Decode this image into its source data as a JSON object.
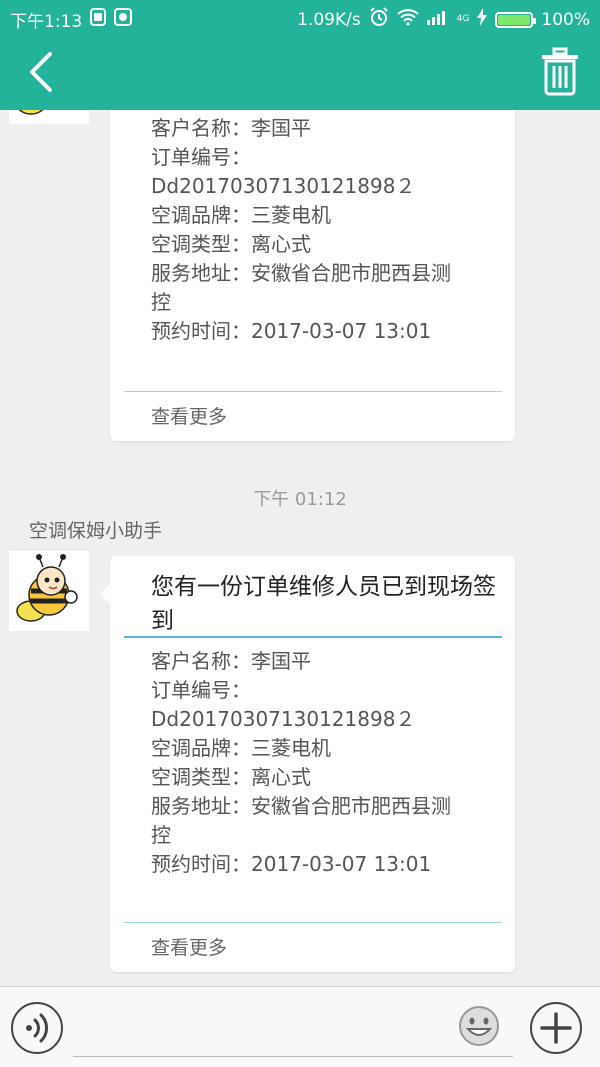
{
  "status_bar": {
    "time": "下午1:13",
    "speed": "1.09K/s",
    "network": "4G",
    "battery": "100%",
    "battery_level": 1.0
  },
  "header": {
    "back_icon": "chevron-left-icon",
    "delete_icon": "trash-icon"
  },
  "messages": [
    {
      "details": [
        "客户名称：李国平",
        "订单编号：",
        "Dd20170307130121898２",
        "空调品牌：三菱电机",
        "空调类型：离心式",
        "服务地址：安徽省合肥市肥西县测",
        "控",
        "预约时间：2017-03-07 13:01"
      ],
      "more": "查看更多"
    },
    {
      "timestamp": "下午 01:12",
      "sender": "空调保姆小助手",
      "title": "您有一份订单维修人员已到现场签到",
      "details": [
        "客户名称：李国平",
        "订单编号：",
        "Dd20170307130121898２",
        "空调品牌：三菱电机",
        "空调类型：离心式",
        "服务地址：安徽省合肥市肥西县测",
        "控",
        "预约时间：2017-03-07 13:01"
      ],
      "more": "查看更多"
    }
  ],
  "input_bar": {
    "placeholder": "",
    "voice_icon": "voice-icon",
    "emoji_icon": "emoji-icon",
    "plus_icon": "plus-icon"
  }
}
